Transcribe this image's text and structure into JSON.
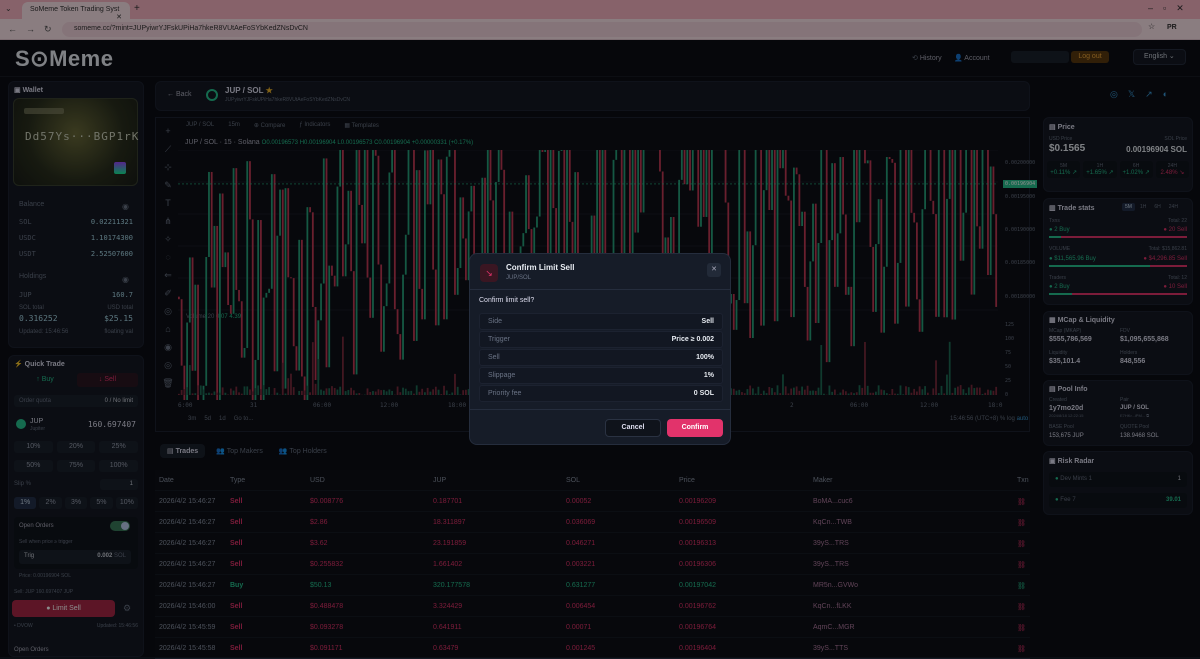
{
  "browser": {
    "tab_title": "SoMeme Token Trading Syst",
    "url": "someme.cc/?mint=JUPyiwrYJFskUPiHa7hkeR8VUtAeFoSYbKedZNsDvCN",
    "profile": "PR"
  },
  "header": {
    "logo": "S⊙Meme",
    "history": "History",
    "account": "Account",
    "logout": "Log out",
    "language": "English"
  },
  "wallet": {
    "title": "Wallet",
    "card_address": "Dd57Ys···BGP1rK",
    "balance_title": "Balance",
    "balances": [
      {
        "sym": "SOL",
        "val": "0.02211321"
      },
      {
        "sym": "USDC",
        "val": "1.10174300"
      },
      {
        "sym": "USDT",
        "val": "2.52507600"
      }
    ],
    "holdings_title": "Holdings",
    "holding_sym": "JUP",
    "holding_amt": "160.7",
    "sol_total_label": "SOL total",
    "usd_total_label": "USD total",
    "sol_total": "0.316252",
    "usd_total": "$25.15",
    "updated": "Updated: 15:46:56",
    "floating": "floating val"
  },
  "quick_trade": {
    "title": "Quick Trade",
    "buy": "Buy",
    "sell": "Sell",
    "order_quota": "Order quota",
    "no_limit": "0 / No limit",
    "token": "JUP",
    "token_sub": "Jupiter",
    "token_amt": "160.697407",
    "pcts": [
      "10%",
      "20%",
      "25%",
      "50%",
      "75%",
      "100%"
    ],
    "slip_label": "Slip %",
    "slip_val": "1",
    "slips": [
      "1%",
      "2%",
      "3%",
      "5%",
      "10%"
    ],
    "open_orders": "Open Orders",
    "sell_when": "Sell when price ≥ trigger",
    "trig_label": "Trig",
    "trig_val": "0.002",
    "trig_unit": "SOL",
    "price_now": "Price: 0.00196904 SOL",
    "sell_summary": "Sell: JUP 160.697407 JUP",
    "limit_sell": "Limit Sell",
    "dvow": "• DVOW",
    "updated2": "Updated: 15:46:56",
    "open_orders2": "Open Orders"
  },
  "pair": {
    "back": "Back",
    "name": "JUP / SOL",
    "mint": "JUPyiwrYJFskUPiHa7hkeR8VUtAeFoSYbKedZNsDvCN"
  },
  "chart_toolbar": {
    "symbol": "JUP / SOL",
    "interval": "15m",
    "compare": "Compare",
    "indicators": "Indicators",
    "templates": "Templates"
  },
  "chart_legend": {
    "title": "JUP / SOL · 15 · Solana",
    "ohlc": "O0.00196573 H0.00196904 L0.00196573 C0.00196904 +0.00000331 (+0.17%)",
    "volume": "Volume 20",
    "vol_val": "0.07",
    "vol_val2": "4.39"
  },
  "chart_axis": {
    "price_ticks": [
      "0.00200000",
      "0.00195000",
      "0.00190000",
      "0.00185000",
      "0.00180000"
    ],
    "current_price": "0.00196904",
    "vol_ticks": [
      "125",
      "100",
      "75",
      "50",
      "25",
      "0"
    ],
    "time_ticks": [
      "6:00",
      "31",
      "06:00",
      "12:00",
      "18:00",
      "2",
      "06:00",
      "12:00",
      "18:0"
    ],
    "ranges": [
      "3m",
      "5d",
      "1d",
      "Go to..."
    ],
    "clock": "15:46:56 (UTC+8)",
    "log": "log",
    "auto": "auto"
  },
  "chart_data": {
    "type": "line",
    "title": "",
    "x": [],
    "series": [
      {
        "name": "",
        "values": [
          0.0018,
          0.00179,
          0.00181,
          0.00182,
          0.00183,
          0.00184,
          0.00185,
          0.00187,
          0.00189,
          0.0019,
          0.00191,
          0.0019,
          0.00192,
          0.00191,
          0.00193,
          0.00195,
          0.00197,
          0.00199,
          0.00201,
          0.00197,
          0.00196,
          0.00195,
          0.00193,
          0.00192,
          0.00189,
          0.0019,
          0.00193,
          0.00195,
          0.00194,
          0.00194,
          0.00196,
          0.00198
        ]
      }
    ],
    "ylim": [
      0.00178,
      0.00202
    ]
  },
  "tabs": {
    "trades": "Trades",
    "makers": "Top Makers",
    "holders": "Top Holders"
  },
  "table": {
    "headers": [
      "Date",
      "Type",
      "USD",
      "JUP",
      "SOL",
      "Price",
      "Maker",
      "Txn"
    ],
    "rows": [
      [
        "2026/4/2 15:46:27",
        "Sell",
        "$0.008776",
        "0.187701",
        "0.00052",
        "0.00196209",
        "BoMA...cuc6"
      ],
      [
        "2026/4/2 15:46:27",
        "Sell",
        "$2.86",
        "18.311897",
        "0.036069",
        "0.00196509",
        "KqCn...TWB"
      ],
      [
        "2026/4/2 15:46:27",
        "Sell",
        "$3.62",
        "23.191859",
        "0.046271",
        "0.00196313",
        "39yS...TRS"
      ],
      [
        "2026/4/2 15:46:27",
        "Sell",
        "$0.255832",
        "1.661402",
        "0.003221",
        "0.00196306",
        "39yS...TRS"
      ],
      [
        "2026/4/2 15:46:27",
        "Buy",
        "$50.13",
        "320.177578",
        "0.631277",
        "0.00197042",
        "MR5n...GVWo"
      ],
      [
        "2026/4/2 15:46:00",
        "Sell",
        "$0.488478",
        "3.324429",
        "0.006454",
        "0.00196762",
        "KqCn...fLKK"
      ],
      [
        "2026/4/2 15:45:59",
        "Sell",
        "$0.093278",
        "0.641911",
        "0.00071",
        "0.00196764",
        "AqmC...MGR"
      ],
      [
        "2026/4/2 15:45:58",
        "Sell",
        "$0.091171",
        "0.63479",
        "0.001245",
        "0.00196404",
        "39yS...TTS"
      ]
    ]
  },
  "price_panel": {
    "title": "Price",
    "usd_label": "USD Price",
    "sol_label": "SOL Price",
    "usd": "$0.1565",
    "sol": "0.00196904 SOL",
    "periods": [
      {
        "p": "5M",
        "v": "+0.11% ↗"
      },
      {
        "p": "1H",
        "v": "+1.65% ↗"
      },
      {
        "p": "6H",
        "v": "+1.02% ↗"
      },
      {
        "p": "24H",
        "v": "2.48% ↘"
      }
    ]
  },
  "trade_stats": {
    "title": "Trade stats",
    "tabs": [
      "5M",
      "1H",
      "6H",
      "24H"
    ],
    "txns": "Txns",
    "total_txns": "Total: 22",
    "buys": "2 Buy",
    "sells": "20 Sell",
    "volume": "VOLUME",
    "total_vol": "Total: $15,862.81",
    "buy_vol": "$11,565.96 Buy",
    "sell_vol": "$4,296.85 Sell",
    "traders": "Traders",
    "total_traders": "Total: 12",
    "buyers": "2 Buy",
    "sellers": "10 Sell"
  },
  "mcap": {
    "title": "MCap & Liquidity",
    "mcap_label": "MCap (MKAP)",
    "fdv_label": "FDV",
    "mcap": "$555,786,569",
    "fdv": "$1,095,655,868",
    "liq_label": "Liquidity",
    "holders_label": "Holders",
    "liq": "$35,101.4",
    "holders": "848,556"
  },
  "pool": {
    "title": "Pool Info",
    "created_label": "Created",
    "pair_label": "Pair",
    "created": "1y7mo20d",
    "created_date": "2024/8/18 12:22:15",
    "pair": "JUP / SOL",
    "pair_sub": "E7HKr...iPM...",
    "base_label": "BASE Pool",
    "quote_label": "QUOTE Pool",
    "base": "153,675 JUP",
    "quote": "138.9468 SOL"
  },
  "risk": {
    "title": "Risk Radar",
    "dev": "Dev Mints",
    "dev_val": "1",
    "dev_count": "1",
    "fee": "Fee",
    "fee_val": "7",
    "fee_count": "39.01"
  },
  "modal": {
    "title": "Confirm Limit Sell",
    "subtitle": "JUP/SOL",
    "question": "Confirm limit sell?",
    "rows": [
      {
        "k": "Side",
        "v": "Sell"
      },
      {
        "k": "Trigger",
        "v": "Price ≥ 0.002"
      },
      {
        "k": "Sell",
        "v": "100%"
      },
      {
        "k": "Slippage",
        "v": "1%"
      },
      {
        "k": "Priority fee",
        "v": "0 SOL"
      }
    ],
    "cancel": "Cancel",
    "confirm": "Confirm"
  },
  "colors": {
    "accent": "#e2336b",
    "green": "#27c28f",
    "bg": "#0b0e14"
  }
}
